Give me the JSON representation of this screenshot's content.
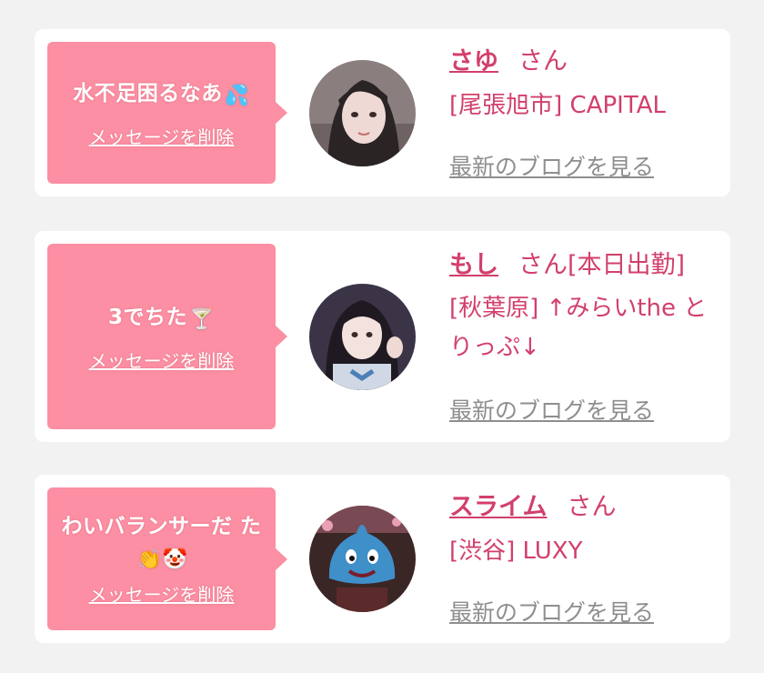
{
  "cards": [
    {
      "message": "水不足困るなあ",
      "message_emoji": "💦",
      "delete_label": "メッセージを削除",
      "name": "さゆ",
      "honorific": "さん",
      "shop": "[尾張旭市] CAPITAL",
      "blog_link": "最新のブログを見る"
    },
    {
      "message": "3でちた",
      "message_emoji": "🍸",
      "delete_label": "メッセージを削除",
      "name": "もし",
      "honorific": "さん[本日出勤]",
      "shop": "[秋葉原] ↑みらいthe とりっぷ↓",
      "blog_link": "最新のブログを見る"
    },
    {
      "message": "わいバランサーだ た",
      "message_emoji": "👏🤡",
      "delete_label": "メッセージを削除",
      "name": "スライム",
      "honorific": "さん",
      "shop": "[渋谷] LUXY",
      "blog_link": "最新のブログを見る"
    }
  ],
  "colors": {
    "page_background": "#f2f2f2",
    "card_background": "#ffffff",
    "bubble": "#fc8fa3",
    "accent": "#d23f6b",
    "link_gray": "#8e8e8e"
  }
}
